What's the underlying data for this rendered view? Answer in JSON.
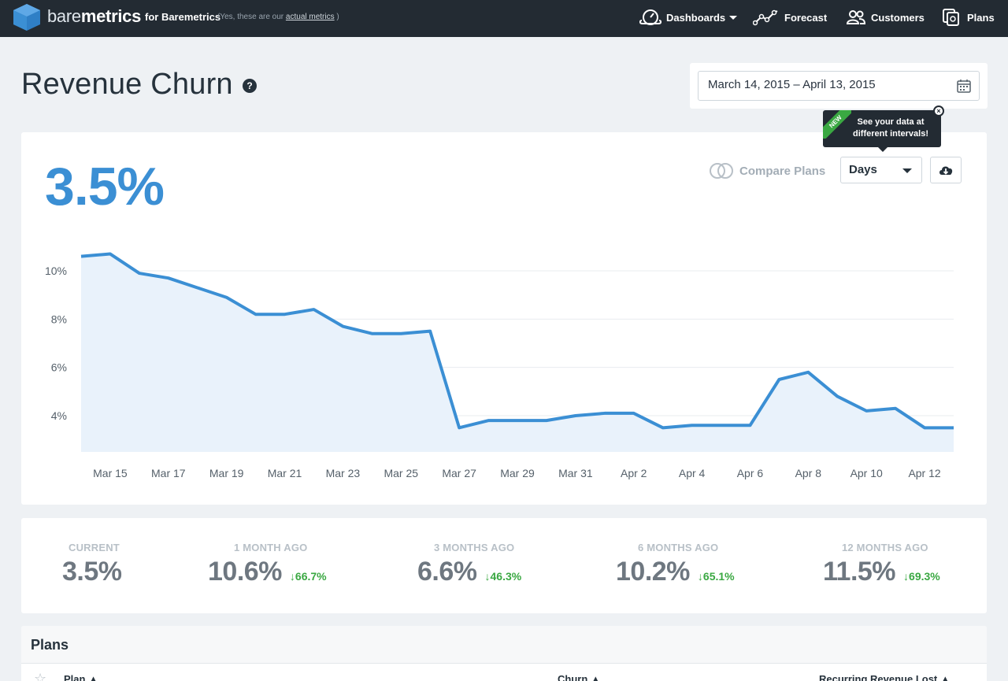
{
  "nav": {
    "brand_light": "bare",
    "brand_bold": "metrics",
    "brand_for": "for Baremetrics",
    "brand_note_prefix": "(Yes, these are our",
    "brand_note_link": "actual metrics",
    "brand_note_suffix": ")",
    "items": [
      {
        "label": "Dashboards",
        "icon": "dashboard-icon"
      },
      {
        "label": "Forecast",
        "icon": "forecast-icon"
      },
      {
        "label": "Customers",
        "icon": "customers-icon"
      },
      {
        "label": "Plans",
        "icon": "plans-icon"
      }
    ]
  },
  "page": {
    "title": "Revenue Churn",
    "help": "?"
  },
  "date_range": {
    "value": "March 14, 2015 – April 13, 2015"
  },
  "tooltip": {
    "badge": "NEW",
    "text_line1": "See your data at",
    "text_line2": "different intervals!",
    "close": "×"
  },
  "chart_card": {
    "metric": "3.5%",
    "compare_label": "Compare Plans",
    "interval": "Days"
  },
  "colors": {
    "accent": "#3b8fd4",
    "area": "#e9f2fb",
    "positive": "#3aa842",
    "nav_bg": "#232b33"
  },
  "chart_data": {
    "type": "area",
    "x": [
      "Mar 14",
      "Mar 15",
      "Mar 16",
      "Mar 17",
      "Mar 18",
      "Mar 19",
      "Mar 20",
      "Mar 21",
      "Mar 22",
      "Mar 23",
      "Mar 24",
      "Mar 25",
      "Mar 26",
      "Mar 27",
      "Mar 28",
      "Mar 29",
      "Mar 30",
      "Mar 31",
      "Apr 1",
      "Apr 2",
      "Apr 3",
      "Apr 4",
      "Apr 5",
      "Apr 6",
      "Apr 7",
      "Apr 8",
      "Apr 9",
      "Apr 10",
      "Apr 11",
      "Apr 12",
      "Apr 13"
    ],
    "series": [
      {
        "values": [
          10.6,
          10.7,
          9.9,
          9.7,
          9.3,
          8.9,
          8.2,
          8.2,
          8.4,
          7.7,
          7.4,
          7.4,
          7.5,
          3.5,
          3.8,
          3.8,
          3.8,
          4.0,
          4.1,
          4.1,
          3.5,
          3.6,
          3.6,
          3.6,
          5.5,
          5.8,
          4.8,
          4.2,
          4.3,
          3.5,
          3.5
        ]
      }
    ],
    "x_tick_labels": [
      "Mar 15",
      "Mar 17",
      "Mar 19",
      "Mar 21",
      "Mar 23",
      "Mar 25",
      "Mar 27",
      "Mar 29",
      "Mar 31",
      "Apr 2",
      "Apr 4",
      "Apr 6",
      "Apr 8",
      "Apr 10",
      "Apr 12"
    ],
    "y_ticks": [
      4,
      6,
      8,
      10
    ],
    "y_tick_labels": [
      "4%",
      "6%",
      "8%",
      "10%"
    ],
    "ylim": [
      2.5,
      11.5
    ],
    "grid": true,
    "title": "",
    "xlabel": "",
    "ylabel": ""
  },
  "stats": [
    {
      "label": "CURRENT",
      "value": "3.5%",
      "delta": ""
    },
    {
      "label": "1 MONTH AGO",
      "value": "10.6%",
      "delta": "66.7%"
    },
    {
      "label": "3 MONTHS AGO",
      "value": "6.6%",
      "delta": "46.3%"
    },
    {
      "label": "6 MONTHS AGO",
      "value": "10.2%",
      "delta": "65.1%"
    },
    {
      "label": "12 MONTHS AGO",
      "value": "11.5%",
      "delta": "69.3%"
    }
  ],
  "plans": {
    "title": "Plans",
    "columns": [
      "Plan",
      "Churn",
      "Recurring Revenue Lost"
    ]
  }
}
